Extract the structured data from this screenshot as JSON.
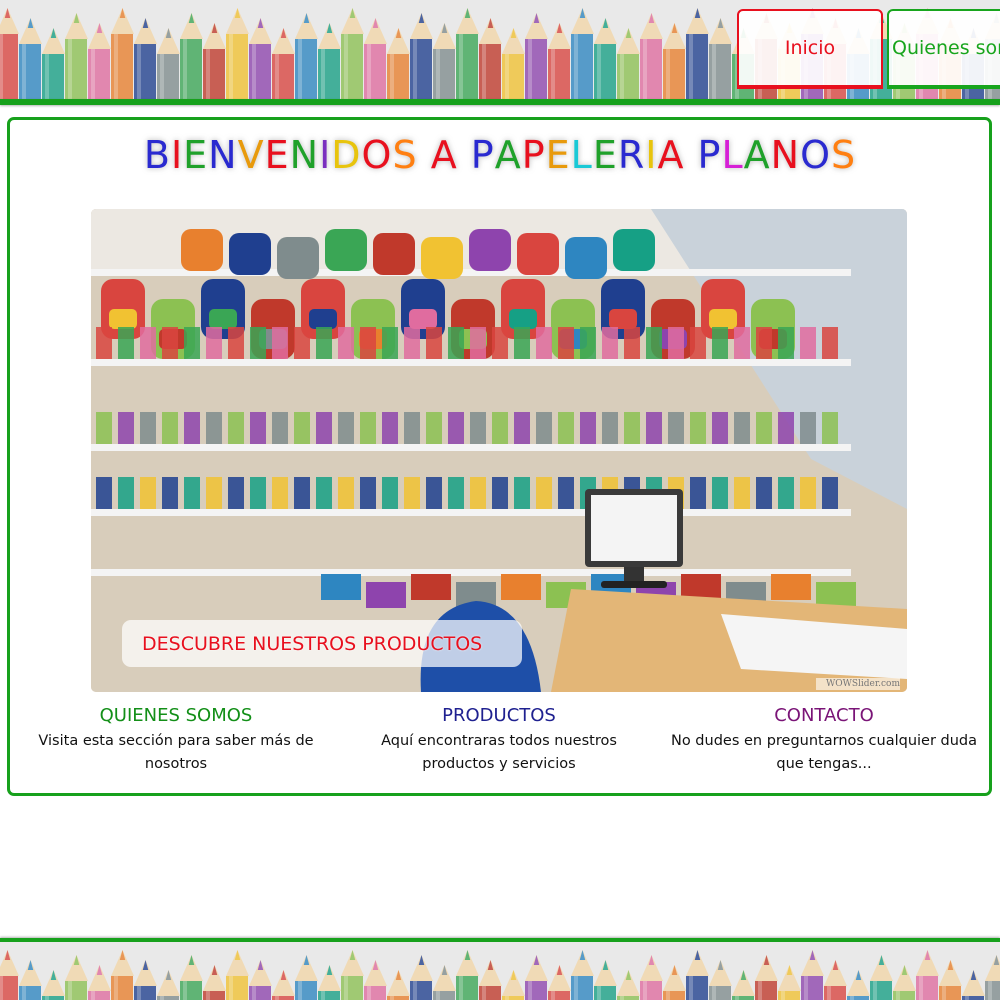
{
  "colors": {
    "green": "#17a11c",
    "red": "#e8101e",
    "navy": "#1f2190",
    "purple": "#7a1477",
    "pencil_palette": [
      "#d9453f",
      "#e8802e",
      "#f1c232",
      "#8cc152",
      "#3aa655",
      "#2e86c1",
      "#1f3f8f",
      "#8e44ad",
      "#e06c9f",
      "#c0392b",
      "#16a085",
      "#7f8c8d"
    ]
  },
  "nav": {
    "items": [
      {
        "label": "Inicio",
        "active": true
      },
      {
        "label": "Quienes somos",
        "active": false
      }
    ]
  },
  "welcome": {
    "letters": [
      {
        "ch": "B",
        "color": "#2a2ad0"
      },
      {
        "ch": "I",
        "color": "#e8101e"
      },
      {
        "ch": "E",
        "color": "#1fa12a"
      },
      {
        "ch": "N",
        "color": "#2a2ad0"
      },
      {
        "ch": "V",
        "color": "#e89a0c"
      },
      {
        "ch": "E",
        "color": "#e8101e"
      },
      {
        "ch": "N",
        "color": "#1fa12a"
      },
      {
        "ch": "I",
        "color": "#7a2fbf"
      },
      {
        "ch": "D",
        "color": "#e8c40c"
      },
      {
        "ch": "O",
        "color": "#e8101e"
      },
      {
        "ch": "S",
        "color": "#ff7f11"
      },
      {
        "ch": " ",
        "color": "#000000"
      },
      {
        "ch": "A",
        "color": "#e8101e"
      },
      {
        "ch": " ",
        "color": "#000000"
      },
      {
        "ch": "P",
        "color": "#2a2ad0"
      },
      {
        "ch": "A",
        "color": "#1fa12a"
      },
      {
        "ch": "P",
        "color": "#e8101e"
      },
      {
        "ch": "E",
        "color": "#e89a0c"
      },
      {
        "ch": "L",
        "color": "#19c9d6"
      },
      {
        "ch": "E",
        "color": "#1fa12a"
      },
      {
        "ch": "R",
        "color": "#2a2ad0"
      },
      {
        "ch": "I",
        "color": "#e8c40c"
      },
      {
        "ch": "A",
        "color": "#e8101e"
      },
      {
        "ch": " ",
        "color": "#000000"
      },
      {
        "ch": "P",
        "color": "#2a2ad0"
      },
      {
        "ch": "L",
        "color": "#d61fd6"
      },
      {
        "ch": "A",
        "color": "#1fa12a"
      },
      {
        "ch": "N",
        "color": "#e8101e"
      },
      {
        "ch": "O",
        "color": "#2a2ad0"
      },
      {
        "ch": "S",
        "color": "#ff7f11"
      }
    ]
  },
  "slider": {
    "caption": "DESCUBRE NUESTROS PRODUCTOS",
    "credit": "WOWSlider.com"
  },
  "sections": [
    {
      "title": "QUIENES SOMOS",
      "text": "Visita esta sección para saber más de nosotros"
    },
    {
      "title": "PRODUCTOS",
      "text": "Aquí encontraras todos nuestros productos y servicios"
    },
    {
      "title": "CONTACTO",
      "text": "No dudes en preguntarnos cualquier duda que tengas..."
    }
  ]
}
